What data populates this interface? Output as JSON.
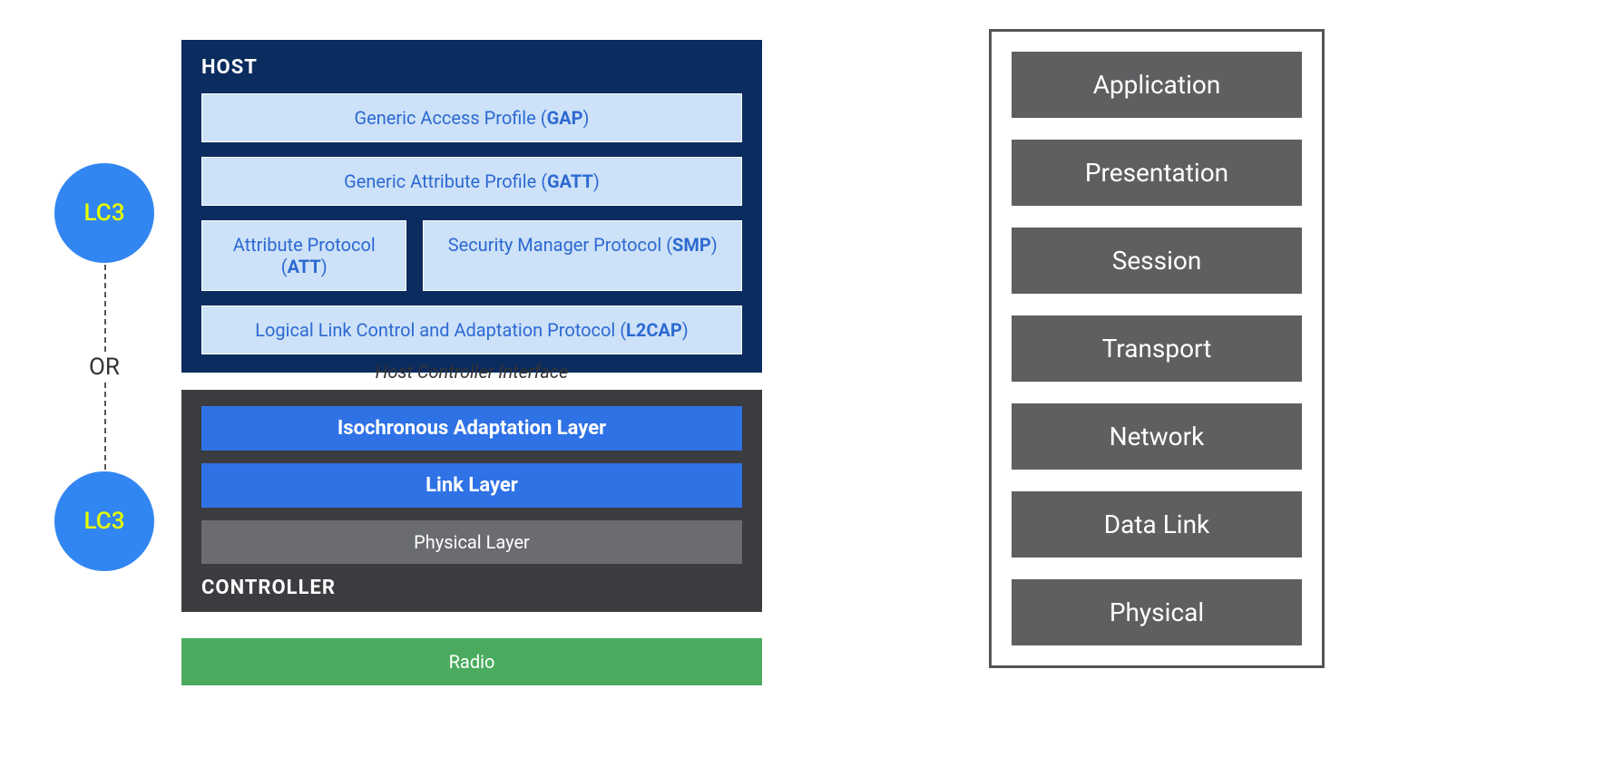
{
  "codec": {
    "lc3_label": "LC3",
    "or_label": "OR"
  },
  "host": {
    "title": "HOST",
    "gap_pre": "Generic Access Profile (",
    "gap_b": "GAP",
    "gap_post": ")",
    "gatt_pre": "Generic Attribute Profile (",
    "gatt_b": "GATT",
    "gatt_post": ")",
    "att_pre": "Attribute Protocol (",
    "att_b": "ATT",
    "att_post": ")",
    "smp_pre": "Security Manager Protocol (",
    "smp_b": "SMP",
    "smp_post": ")",
    "l2cap_pre": "Logical Link Control and Adaptation Protocol (",
    "l2cap_b": "L2CAP",
    "l2cap_post": ")"
  },
  "hci_label": "Host Controller Interface",
  "controller": {
    "title": "CONTROLLER",
    "ial": "Isochronous Adaptation Layer",
    "link": "Link Layer",
    "phy": "Physical Layer"
  },
  "radio": "Radio",
  "osi": {
    "layers": [
      "Application",
      "Presentation",
      "Session",
      "Transport",
      "Network",
      "Data Link",
      "Physical"
    ]
  }
}
